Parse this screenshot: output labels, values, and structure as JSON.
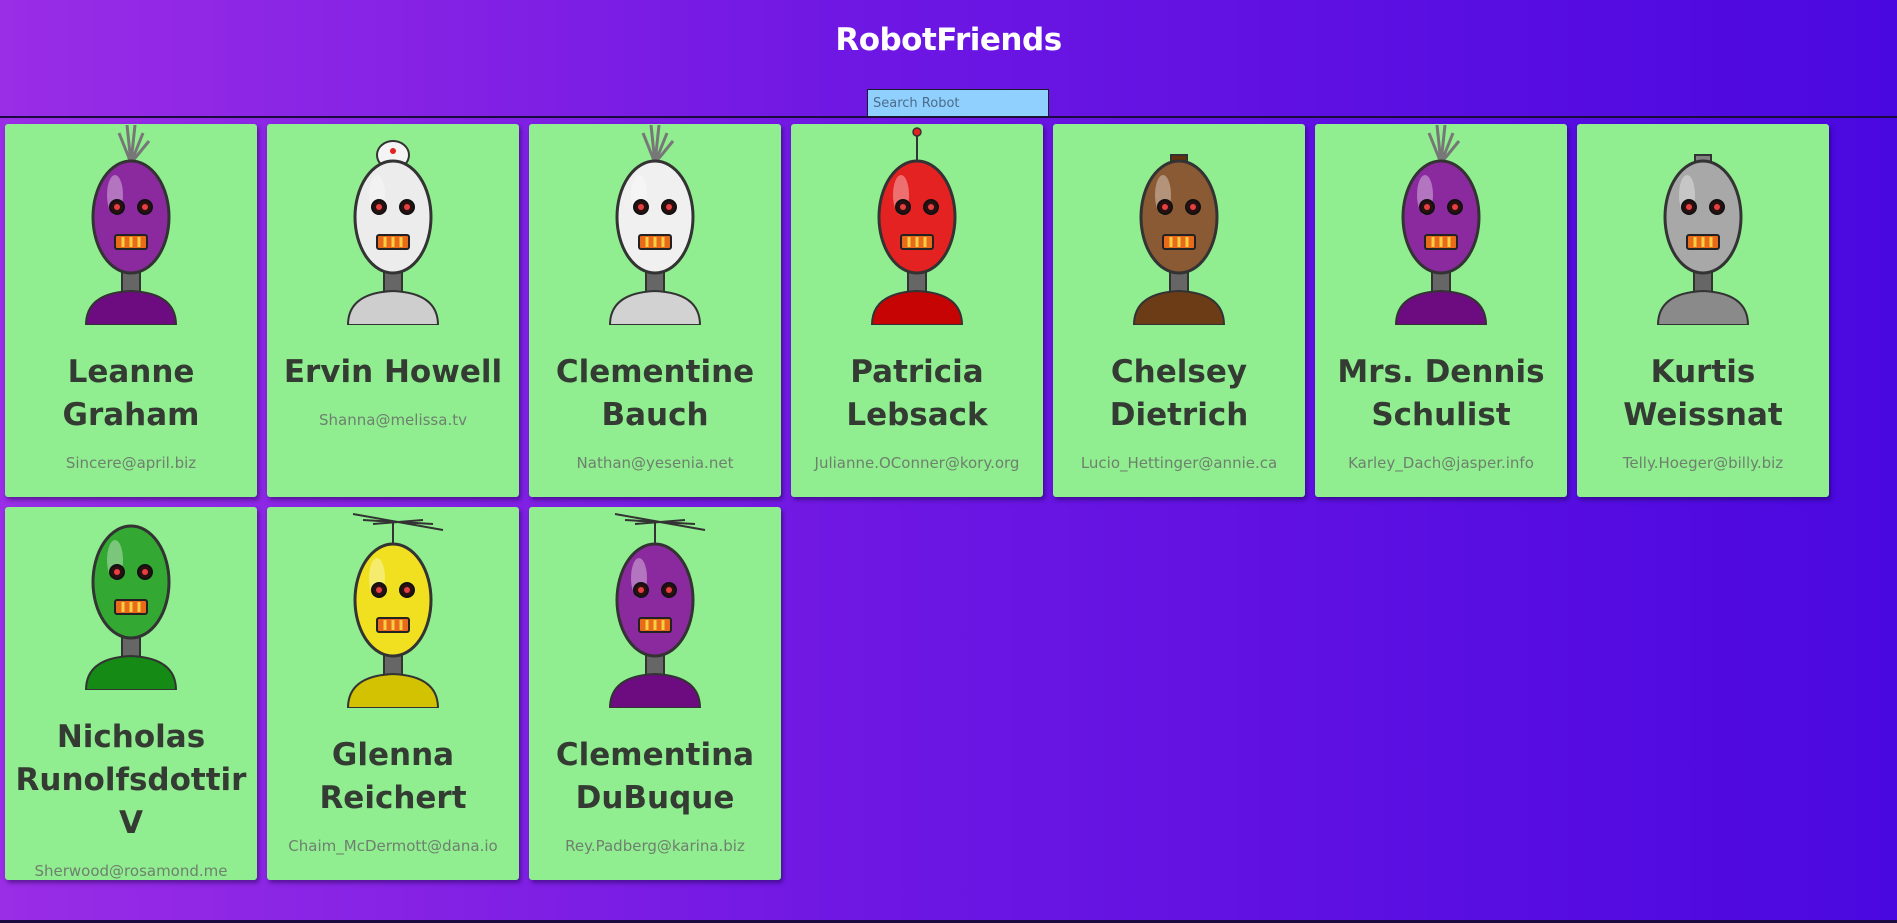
{
  "app": {
    "title": "RobotFriends"
  },
  "search": {
    "placeholder": "Search Robot",
    "value": ""
  },
  "colors": {
    "card": "#90ee90",
    "bg_start": "#9a2de6",
    "bg_end": "#4a08e0",
    "search": "#8fd0ff"
  },
  "robots": [
    {
      "name": "Leanne Graham",
      "email": "Sincere@april.biz",
      "color": "#8a2a9e",
      "top": "spikes"
    },
    {
      "name": "Ervin Howell",
      "email": "Shanna@melissa.tv",
      "color": "#ececec",
      "top": "dish"
    },
    {
      "name": "Clementine Bauch",
      "email": "Nathan@yesenia.net",
      "color": "#f0f0f0",
      "top": "spikes"
    },
    {
      "name": "Patricia Lebsack",
      "email": "Julianne.OConner@kory.org",
      "color": "#e52222",
      "top": "antenna"
    },
    {
      "name": "Chelsey Dietrich",
      "email": "Lucio_Hettinger@annie.ca",
      "color": "#8a5a34",
      "top": "knob"
    },
    {
      "name": "Mrs. Dennis Schulist",
      "email": "Karley_Dach@jasper.info",
      "color": "#8a2a9e",
      "top": "spikes"
    },
    {
      "name": "Kurtis Weissnat",
      "email": "Telly.Hoeger@billy.biz",
      "color": "#a8a8a8",
      "top": "knob"
    },
    {
      "name": "Nicholas Runolfsdottir V",
      "email": "Sherwood@rosamond.me",
      "color": "#33a833",
      "top": "none"
    },
    {
      "name": "Glenna Reichert",
      "email": "Chaim_McDermott@dana.io",
      "color": "#f0e020",
      "top": "tv"
    },
    {
      "name": "Clementina DuBuque",
      "email": "Rey.Padberg@karina.biz",
      "color": "#8a2a9e",
      "top": "tv"
    }
  ]
}
